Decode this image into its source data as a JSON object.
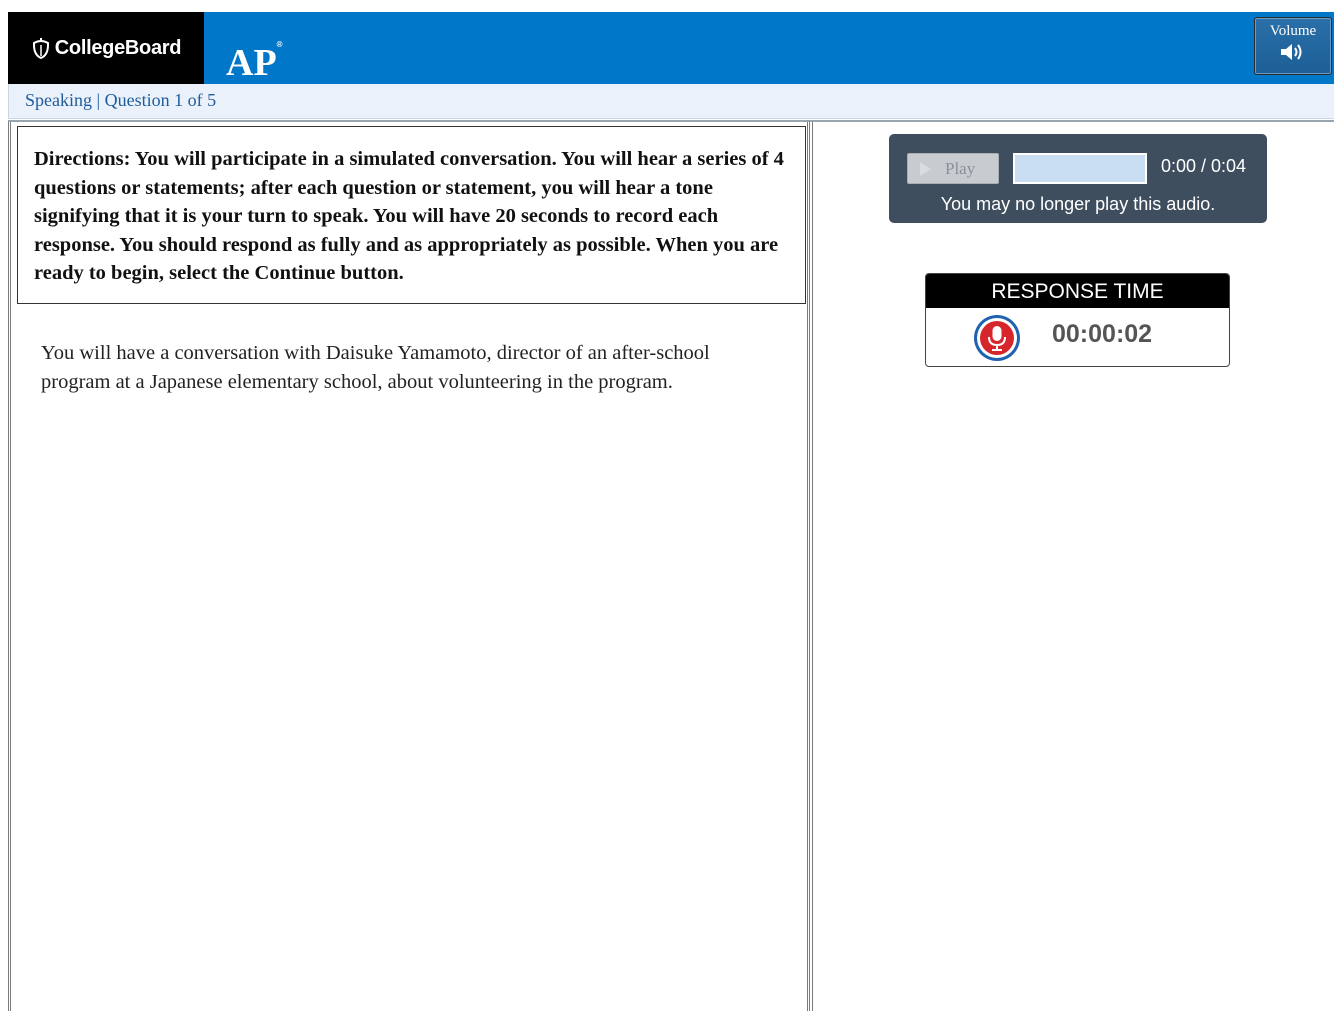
{
  "header": {
    "brand": "CollegeBoard",
    "product": "AP",
    "product_mark": "®",
    "volume_label": "Volume"
  },
  "breadcrumb": "Speaking | Question 1 of 5",
  "directions": "Directions: You will participate in a simulated conversation. You will hear a series of 4 questions or statements; after each question or statement, you will hear a tone signifying that it is your turn to speak. You will have 20 seconds to record each response. You should respond as fully and as appropriately as possible. When you are ready to begin, select the Continue button.",
  "prompt": "You will have a conversation with Daisuke Yamamoto, director of an after-school program at a Japanese elementary school, about volunteering in the program.",
  "audio_player": {
    "play_label": "Play",
    "time": "0:00 / 0:04",
    "notice": "You may no longer play this audio.",
    "progress_fraction": 0
  },
  "response_time": {
    "label": "RESPONSE TIME",
    "value": "00:00:02"
  },
  "colors": {
    "header_blue": "#0077c8",
    "player_bg": "#3f4e5e",
    "mic_red": "#d7262b",
    "mic_ring_blue": "#1f63b0"
  }
}
